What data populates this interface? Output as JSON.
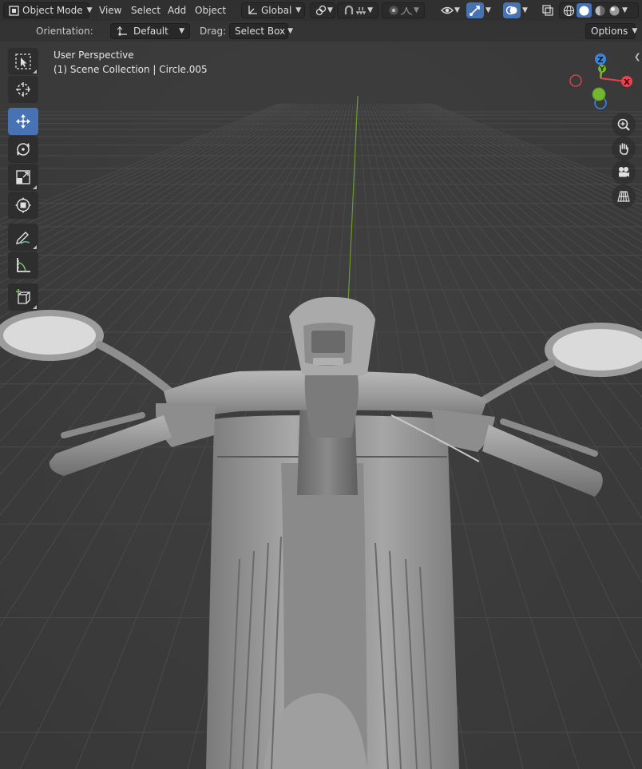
{
  "header": {
    "mode_label": "Object Mode",
    "menus": [
      "View",
      "Select",
      "Add",
      "Object"
    ],
    "transform_orientation": "Global"
  },
  "tool_settings": {
    "orientation_label": "Orientation:",
    "orientation_value": "Default",
    "drag_label": "Drag:",
    "drag_value": "Select Box",
    "options_label": "Options"
  },
  "viewport": {
    "perspective_label": "User Perspective",
    "collection_label": "(1) Scene Collection | Circle.005",
    "gizmo": {
      "x": "X",
      "y": "Y",
      "z": "Z"
    }
  },
  "toolbar": {
    "tools": [
      "select-box",
      "cursor",
      "move",
      "rotate",
      "scale",
      "transform",
      "annotate",
      "measure",
      "add-cube"
    ],
    "active_tool": "move"
  },
  "colors": {
    "accent": "#4772b3",
    "axis_x": "#e8424f",
    "axis_y": "#74b62f",
    "axis_z": "#3b86d6"
  }
}
